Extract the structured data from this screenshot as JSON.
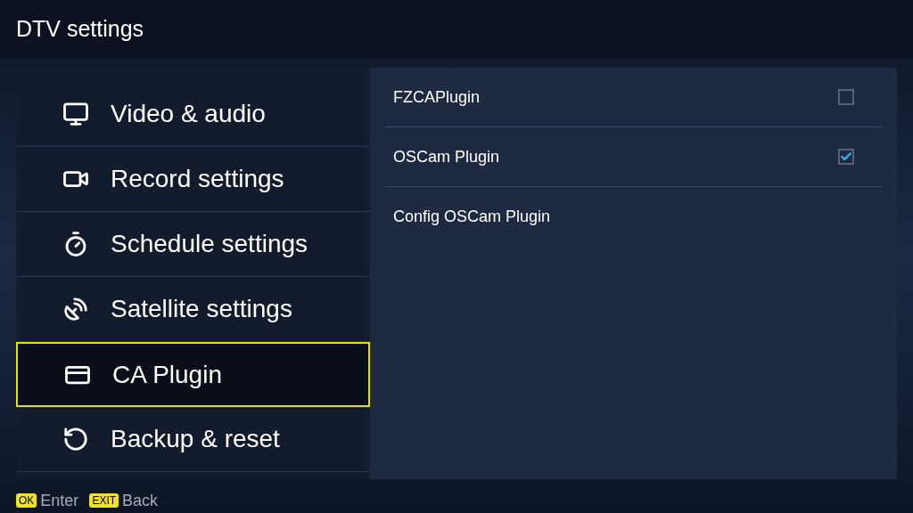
{
  "window": {
    "title": "DTV settings"
  },
  "sidebar": {
    "items": [
      {
        "label": "Video & audio",
        "selected": false
      },
      {
        "label": "Record settings",
        "selected": false
      },
      {
        "label": "Schedule settings",
        "selected": false
      },
      {
        "label": "Satellite settings",
        "selected": false
      },
      {
        "label": "CA Plugin",
        "selected": true
      },
      {
        "label": "Backup & reset",
        "selected": false
      }
    ]
  },
  "options": [
    {
      "kind": "checkbox",
      "label": "FZCAPlugin",
      "checked": false
    },
    {
      "kind": "checkbox",
      "label": "OSCam Plugin",
      "checked": true
    },
    {
      "kind": "action",
      "label": "Config OSCam Plugin"
    }
  ],
  "footer": [
    {
      "key": "OK",
      "label": "Enter"
    },
    {
      "key": "EXIT",
      "label": "Back"
    }
  ]
}
